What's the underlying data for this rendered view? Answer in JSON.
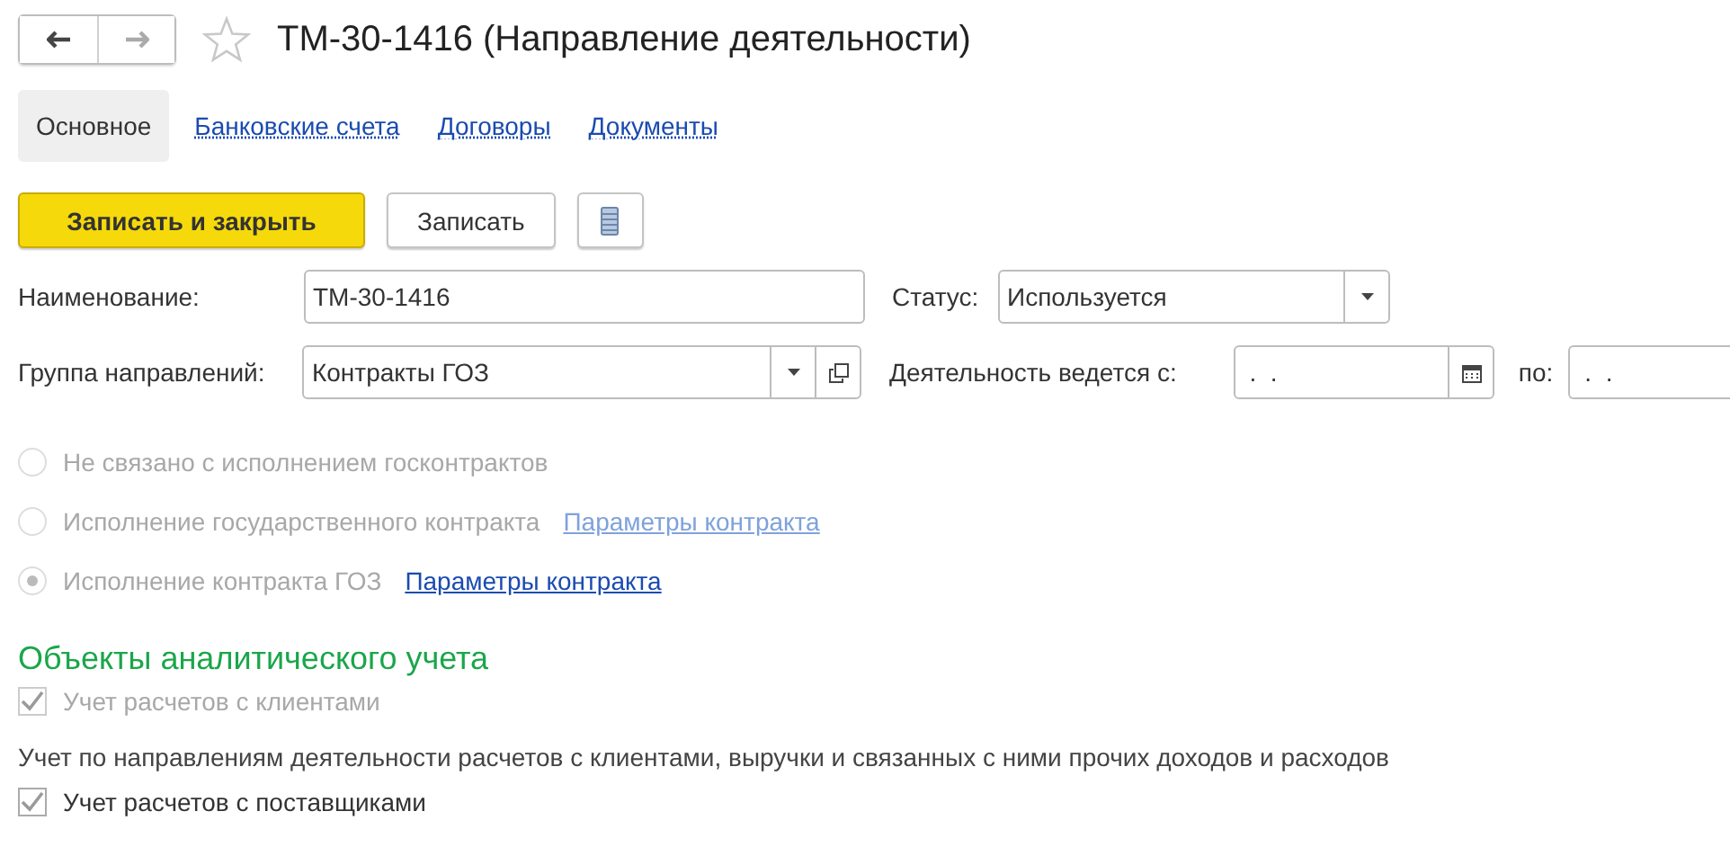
{
  "window": {
    "title": "ТМ-30-1416 (Направление деятельности)",
    "favorite": false
  },
  "tabs": [
    {
      "label": "Основное",
      "selected": true
    },
    {
      "label": "Банковские счета",
      "selected": false
    },
    {
      "label": "Договоры",
      "selected": false
    },
    {
      "label": "Документы",
      "selected": false
    }
  ],
  "toolbar": {
    "buttons": [
      {
        "label": "Записать и закрыть",
        "kind": "primary"
      },
      {
        "label": "Записать",
        "kind": "normal"
      },
      {
        "kind": "list"
      }
    ]
  },
  "fields": {
    "name": {
      "label": "Наименование:",
      "value": "ТМ-30-1416"
    },
    "status": {
      "label": "Статус:",
      "value": "Используется"
    },
    "group": {
      "label": "Группа направлений:",
      "value": "Контракты ГОЗ"
    },
    "period_from": {
      "label": "Деятельность ведется с:",
      "value": " .  ."
    },
    "period_to": {
      "label": "по:",
      "value": " .  ."
    }
  },
  "contract_options": [
    {
      "label": "Не связано с исполнением госконтрактов",
      "selected": false,
      "disabled": true
    },
    {
      "label": "Исполнение государственного контракта",
      "selected": false,
      "disabled": true,
      "link": {
        "label": "Параметры контракта",
        "disabled": true
      }
    },
    {
      "label": "Исполнение контракта ГОЗ",
      "selected": true,
      "disabled": true,
      "link": {
        "label": "Параметры контракта",
        "disabled": false
      }
    }
  ],
  "analytics": {
    "heading": "Объекты аналитического учета",
    "items": [
      {
        "kind": "checkbox",
        "label": "Учет расчетов с клиентами",
        "checked": true,
        "disabled": true
      },
      {
        "kind": "note",
        "text": "Учет по направлениям деятельности расчетов с клиентами, выручки и связанных с ними прочих доходов и расходов"
      },
      {
        "kind": "checkbox",
        "label": "Учет расчетов с поставщиками",
        "checked": true,
        "disabled": false
      }
    ]
  }
}
